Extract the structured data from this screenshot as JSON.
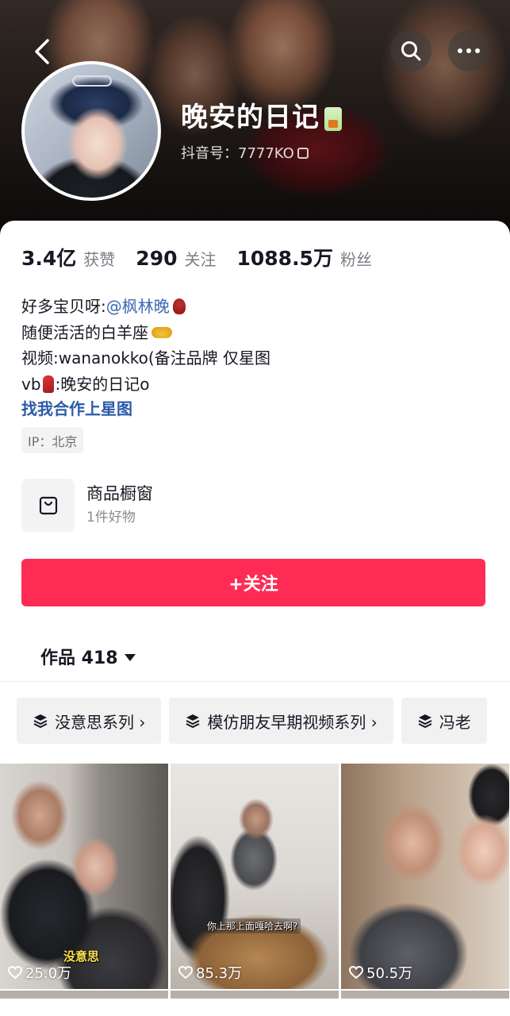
{
  "profile": {
    "name": "晚安的日记",
    "douyin_id": "抖音号：7777KO"
  },
  "stats": [
    {
      "value": "3.4亿",
      "label": "获赞"
    },
    {
      "value": "290",
      "label": "关注"
    },
    {
      "value": "1088.5万",
      "label": "粉丝"
    }
  ],
  "bio": {
    "line1_prefix": "好多宝贝呀:",
    "line1_mention": "@枫林晚",
    "line2": "随便活活的白羊座",
    "line3": "视频:wananokko(备注品牌 仅星图",
    "line4_prefix": "vb",
    "line4_suffix": ":晚安的日记o",
    "link": "找我合作上星图",
    "ip": "IP：北京"
  },
  "shop": {
    "title": "商品橱窗",
    "subtitle": "1件好物"
  },
  "follow_button": "+关注",
  "works": {
    "label": "作品 418"
  },
  "series": [
    {
      "label": "没意思系列 ›"
    },
    {
      "label": "模仿朋友早期视频系列 ›"
    },
    {
      "label": "冯老"
    }
  ],
  "videos": [
    {
      "likes": "25.0万",
      "caption": "没意思"
    },
    {
      "likes": "85.3万",
      "caption": "你上那上面嘎哈去啊?"
    },
    {
      "likes": "50.5万"
    }
  ],
  "colors": {
    "accent": "#fe2c55",
    "link": "#2c5aa8"
  }
}
